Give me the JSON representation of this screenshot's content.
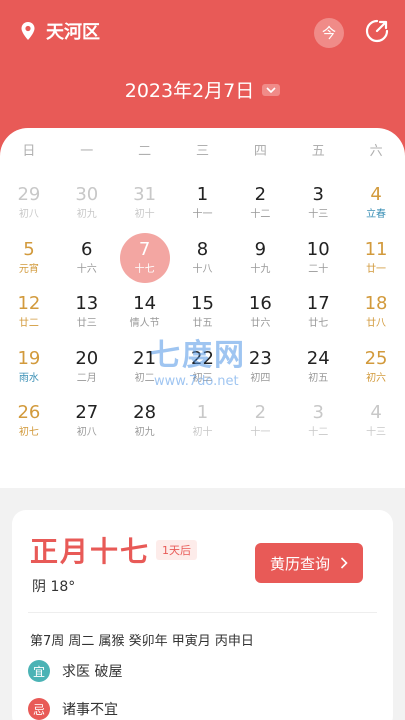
{
  "header": {
    "location": "天河区",
    "today_label": "今",
    "date_title": "2023年2月7日"
  },
  "weekdays": [
    "日",
    "一",
    "二",
    "三",
    "四",
    "五",
    "六"
  ],
  "calendar": [
    {
      "num": "29",
      "lunar": "初八",
      "kind": "other"
    },
    {
      "num": "30",
      "lunar": "初九",
      "kind": "other"
    },
    {
      "num": "31",
      "lunar": "初十",
      "kind": "other"
    },
    {
      "num": "1",
      "lunar": "十一",
      "kind": "normal"
    },
    {
      "num": "2",
      "lunar": "十二",
      "kind": "normal"
    },
    {
      "num": "3",
      "lunar": "十三",
      "kind": "normal"
    },
    {
      "num": "4",
      "lunar": "立春",
      "kind": "weekend",
      "term": true
    },
    {
      "num": "5",
      "lunar": "元宵",
      "kind": "weekend",
      "fest": true
    },
    {
      "num": "6",
      "lunar": "十六",
      "kind": "normal"
    },
    {
      "num": "7",
      "lunar": "十七",
      "kind": "selected"
    },
    {
      "num": "8",
      "lunar": "十八",
      "kind": "normal"
    },
    {
      "num": "9",
      "lunar": "十九",
      "kind": "normal"
    },
    {
      "num": "10",
      "lunar": "二十",
      "kind": "normal"
    },
    {
      "num": "11",
      "lunar": "廿一",
      "kind": "weekend",
      "fest": true
    },
    {
      "num": "12",
      "lunar": "廿二",
      "kind": "weekend",
      "fest": true
    },
    {
      "num": "13",
      "lunar": "廿三",
      "kind": "normal"
    },
    {
      "num": "14",
      "lunar": "情人节",
      "kind": "normal"
    },
    {
      "num": "15",
      "lunar": "廿五",
      "kind": "normal"
    },
    {
      "num": "16",
      "lunar": "廿六",
      "kind": "normal"
    },
    {
      "num": "17",
      "lunar": "廿七",
      "kind": "normal"
    },
    {
      "num": "18",
      "lunar": "廿八",
      "kind": "weekend",
      "fest": true
    },
    {
      "num": "19",
      "lunar": "雨水",
      "kind": "weekend",
      "term": true
    },
    {
      "num": "20",
      "lunar": "二月",
      "kind": "normal"
    },
    {
      "num": "21",
      "lunar": "初二",
      "kind": "normal"
    },
    {
      "num": "22",
      "lunar": "初三",
      "kind": "normal"
    },
    {
      "num": "23",
      "lunar": "初四",
      "kind": "normal"
    },
    {
      "num": "24",
      "lunar": "初五",
      "kind": "normal"
    },
    {
      "num": "25",
      "lunar": "初六",
      "kind": "weekend",
      "fest": true
    },
    {
      "num": "26",
      "lunar": "初七",
      "kind": "weekend",
      "fest": true
    },
    {
      "num": "27",
      "lunar": "初八",
      "kind": "normal"
    },
    {
      "num": "28",
      "lunar": "初九",
      "kind": "normal"
    },
    {
      "num": "1",
      "lunar": "初十",
      "kind": "other"
    },
    {
      "num": "2",
      "lunar": "十一",
      "kind": "other"
    },
    {
      "num": "3",
      "lunar": "十二",
      "kind": "other"
    },
    {
      "num": "4",
      "lunar": "十三",
      "kind": "other"
    }
  ],
  "watermark": {
    "main": "七度网",
    "sub": "www.7do.net"
  },
  "card": {
    "lunar_date": "正月十七",
    "days_after": "1天后",
    "weather": "阴 18°",
    "almanac_button": "黄历查询",
    "info_line": "第7周 周二 属猴 癸卯年 甲寅月 丙申日",
    "yi_label": "宜",
    "yi_text": "求医 破屋",
    "ji_label": "忌",
    "ji_text": "诸事不宜"
  },
  "colors": {
    "accent": "#e85a57",
    "weekend": "#d29a3c",
    "solar_term": "#3a8fb5",
    "yi": "#4bb3b5"
  }
}
